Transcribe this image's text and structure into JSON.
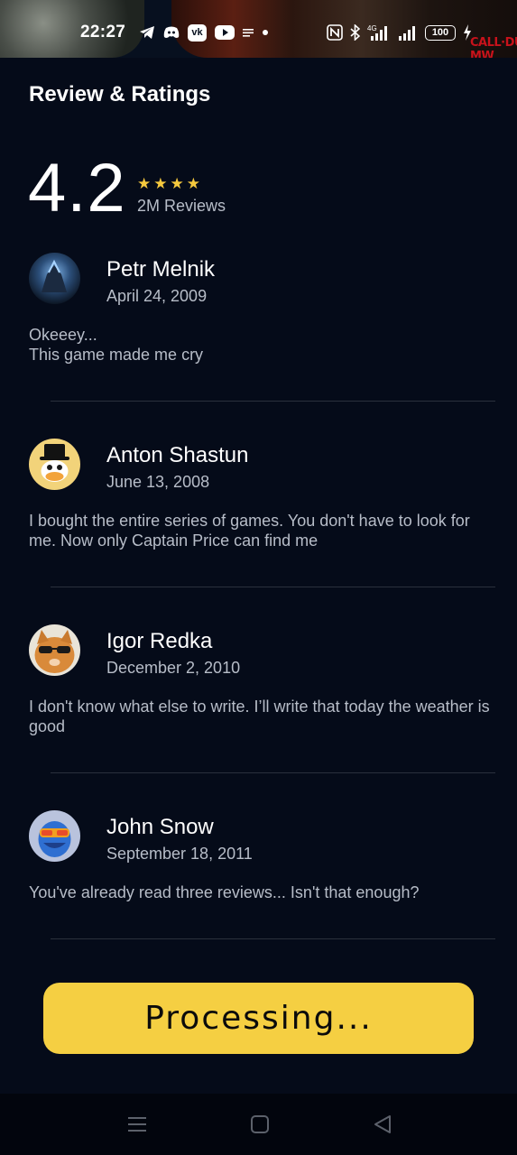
{
  "status_bar": {
    "time": "22:27",
    "icons_left": [
      "telegram-icon",
      "discord-icon",
      "vk-icon",
      "youtube-icon",
      "menu-lines-icon",
      "dot-icon"
    ],
    "icons_right": [
      "nfc-icon",
      "bluetooth-icon",
      "signal-4g-icon",
      "signal-icon",
      "battery-icon",
      "charging-icon"
    ],
    "network": "4G",
    "battery": "100",
    "brand_logo": "CALL·DUTY MW"
  },
  "page": {
    "title": "Review & Ratings"
  },
  "rating": {
    "score": "4.2",
    "stars_filled": 4,
    "reviews_count": "2M Reviews",
    "star_color": "#f6c93e"
  },
  "reviews": [
    {
      "name": "Petr Melnik",
      "date": "April 24, 2009",
      "text": "Okeeey...\nThis game made me cry",
      "avatar": "dark-knight-avatar"
    },
    {
      "name": "Anton Shastun",
      "date": "June 13, 2008",
      "text": "I bought the entire series of games. You don't have to look for me. Now only Captain Price can find me",
      "avatar": "scrooge-duck-avatar"
    },
    {
      "name": "Igor Redka",
      "date": "December 2, 2010",
      "text": "I don't know what else to write. I’ll write that today the weather is good",
      "avatar": "cat-sunglasses-avatar"
    },
    {
      "name": "John Snow",
      "date": "September 18, 2011",
      "text": "You've already read three reviews... Isn't that enough?",
      "avatar": "colorful-mask-avatar"
    }
  ],
  "action_button": {
    "label": "Processing...",
    "color": "#f5cf42"
  },
  "nav_bar": {
    "buttons": [
      "recents-icon",
      "home-icon",
      "back-icon"
    ]
  },
  "colors": {
    "background": "#050b19",
    "secondary_text": "#b7bdc8",
    "divider": "#2a303c"
  }
}
